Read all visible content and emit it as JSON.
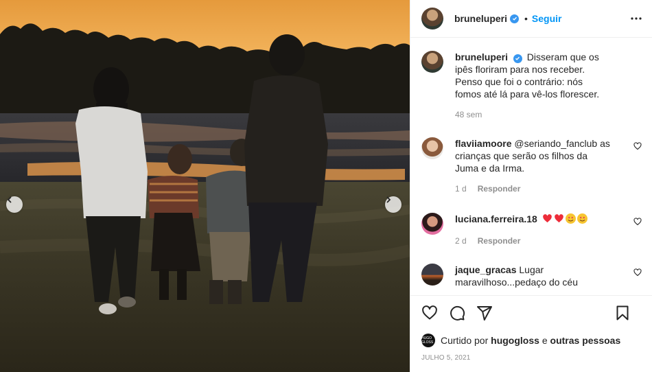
{
  "post": {
    "username": "bruneluperi",
    "follow_label": "Seguir",
    "caption": "Disseram que os ipês floriram para nos receber. Penso que foi o contrário: nós fomos até lá para vê-los florescer.",
    "caption_time": "48 sem"
  },
  "comments": [
    {
      "username": "flaviiamoore",
      "text": "@seriando_fanclub as crianças que serão os filhos da Juma e da Irma.",
      "time": "1 d",
      "reply_label": "Responder"
    },
    {
      "username": "luciana.ferreira.18",
      "text": "",
      "time": "2 d",
      "reply_label": "Responder"
    },
    {
      "username": "jaque_gracas",
      "text": "Lugar maravilhoso...pedaço do céu",
      "time": "",
      "reply_label": ""
    }
  ],
  "likes": {
    "prefix": "Curtido por",
    "liker": "hugogloss",
    "connector": "e",
    "suffix": "outras pessoas",
    "liker_avatar_text": "HUGO GLOSS"
  },
  "date": "JULHO 5, 2021",
  "icons": [
    "chevron-left-icon",
    "chevron-right-icon",
    "verified-icon",
    "more-icon",
    "heart-icon",
    "comment-icon",
    "share-icon",
    "bookmark-icon"
  ],
  "colors": {
    "accent": "#0095f6",
    "verified": "#3897f0",
    "muted": "#8e8e8e",
    "heart_red": "#ed2d3a"
  }
}
